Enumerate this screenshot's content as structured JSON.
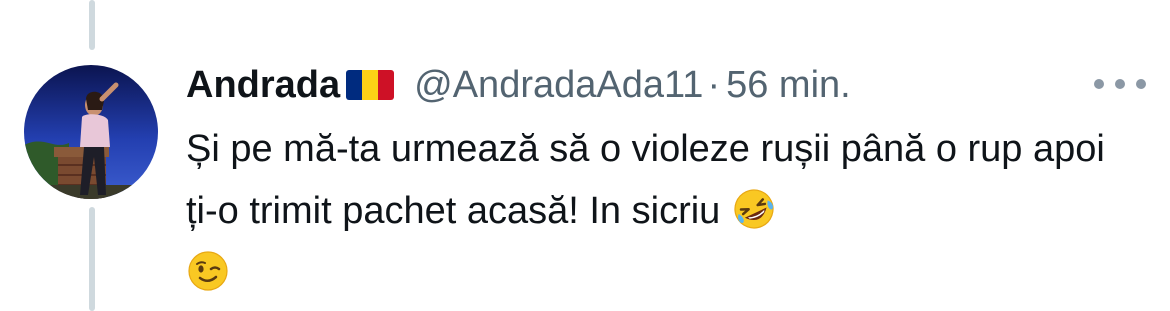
{
  "tweet": {
    "display_name": "Andrada",
    "handle": "@AndradaAda11",
    "separator": "·",
    "time": "56 min.",
    "text": "Și pe mă-ta urmează să o violeze rușii până o rup apoi ți-o trimit pachet acasă! In sicriu",
    "emojis": [
      "rolling-on-floor-laughing-emoji",
      "winking-face-emoji"
    ],
    "flag_icon": "romania-flag-icon",
    "flag_colors": [
      "#002B7F",
      "#FCD116",
      "#CE1126"
    ]
  },
  "colors": {
    "text": "#0f1419",
    "secondary": "#536471",
    "thread_line": "#cfd9de"
  }
}
